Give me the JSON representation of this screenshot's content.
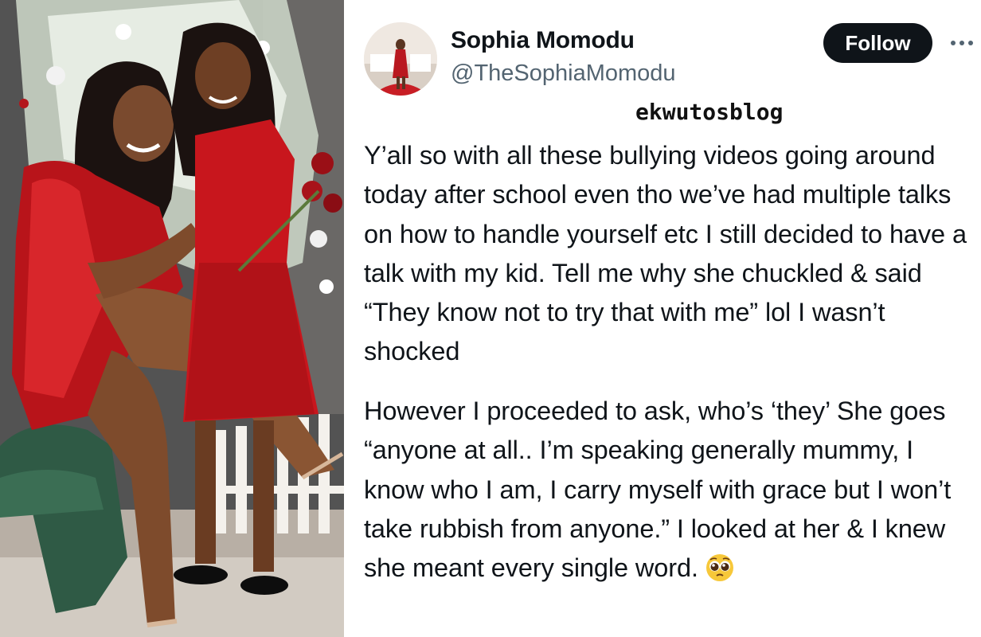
{
  "photo": {
    "description_icon": "photo"
  },
  "tweet": {
    "author": {
      "name": "Sophia Momodu",
      "handle": "@TheSophiaMomodu"
    },
    "follow_label": "Follow",
    "more_icon": "more-horizontal-icon",
    "watermark": "ekwutosblog",
    "paragraph_1": "Y’all so with all these bullying videos going around today after school even tho we’ve had multiple talks on how to handle yourself etc I still decided to have a talk with my kid. Tell me why she chuckled & said “They know not to try that with me” lol I wasn’t shocked",
    "paragraph_2": "However I proceeded to ask, who’s ‘they’ She goes “anyone at all.. I’m speaking generally mummy, I know who I am, I carry myself with grace but I won’t take rubbish from anyone.” I looked at her & I knew she meant every single word.",
    "emoji_icon": "pleading-face-emoji"
  },
  "colors": {
    "text": "#0f1419",
    "secondary_text": "#536471",
    "follow_bg": "#0f1419",
    "follow_text": "#ffffff"
  }
}
